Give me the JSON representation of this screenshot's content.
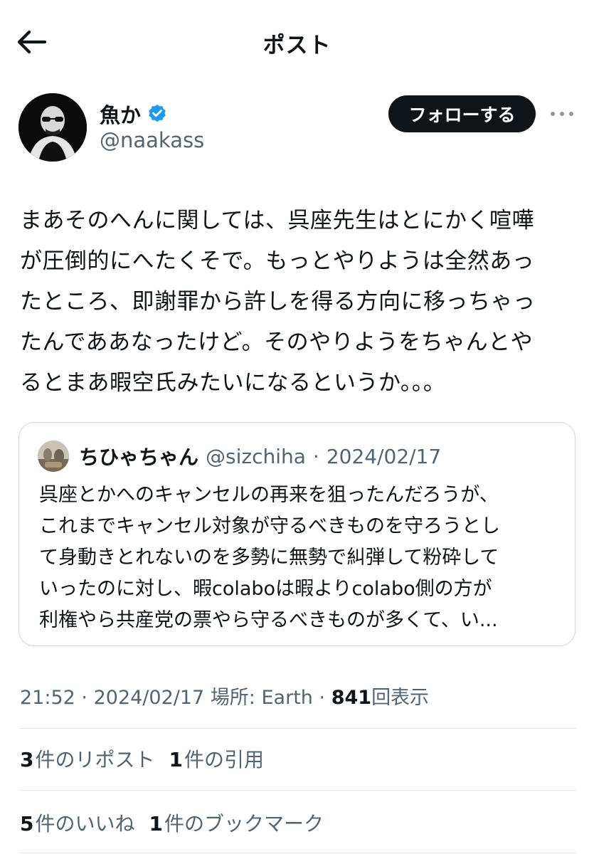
{
  "header": {
    "title": "ポスト"
  },
  "author": {
    "name": "魚か",
    "handle": "@naakass",
    "verified": true,
    "follow_label": "フォローする"
  },
  "tweet": {
    "text": "まあそのへんに関しては、呉座先生はとにかく喧嘩\nが圧倒的にへたくそで。もっとやりようは全然あっ\nたところ、即謝罪から許しを得る方向に移っちゃっ\nたんでああなったけど。そのやりようをちゃんとや\nるとまあ暇空氏みたいになるというか。。。"
  },
  "quote": {
    "name": "ちひゃちゃん",
    "handle": "@sizchiha",
    "separator": "·",
    "date": "2024/02/17",
    "text": "呉座とかへのキャンセルの再来を狙ったんだろうが、\nこれまでキャンセル対象が守るべきものを守ろうとし\nて身動きとれないのを多勢に無勢で糾弾して粉砕して\nいったのに対し、暇colaboは暇よりcolabo側の方が\n利権やら共産党の票やら守るべきものが多くて、い..."
  },
  "meta": {
    "time": "21:52",
    "separator": "·",
    "date": "2024/02/17",
    "location": "場所: Earth",
    "views_count": "841",
    "views_label": "回表示"
  },
  "stats": {
    "reposts_count": "3",
    "reposts_label": "件のリポスト",
    "quotes_count": "1",
    "quotes_label": "件の引用",
    "likes_count": "5",
    "likes_label": "件のいいね",
    "bookmarks_count": "1",
    "bookmarks_label": "件のブックマーク"
  },
  "colors": {
    "text": "#0f1419",
    "secondary": "#536471",
    "verified": "#1d9bf0",
    "border": "#cfd9de"
  },
  "icons": {
    "back": "arrow-left-icon",
    "verified": "verified-badge-icon",
    "more": "more-horizontal-icon"
  }
}
